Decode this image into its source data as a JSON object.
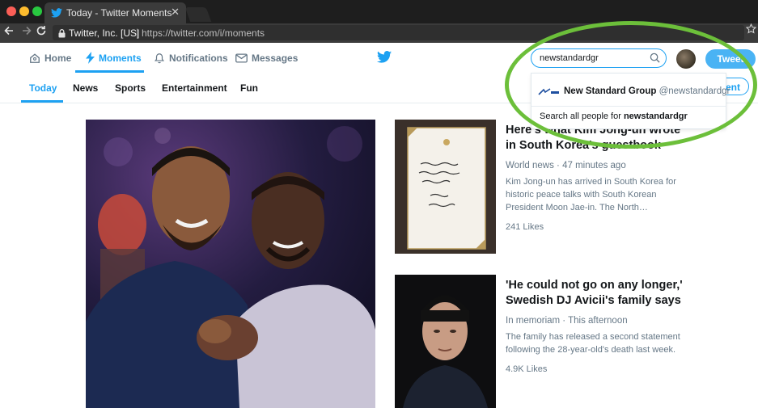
{
  "browser": {
    "tab_title": "Today - Twitter Moments",
    "tab_close": "✕",
    "origin": "Twitter, Inc. [US]",
    "separator": "|",
    "url": "https://twitter.com/i/moments"
  },
  "header": {
    "nav": [
      {
        "label": "Home",
        "icon": "home-icon"
      },
      {
        "label": "Moments",
        "icon": "lightning-icon",
        "active": true
      },
      {
        "label": "Notifications",
        "icon": "bell-icon"
      },
      {
        "label": "Messages",
        "icon": "envelope-icon"
      }
    ],
    "search_value": "newstandardgr",
    "tweet_label": "Tweet"
  },
  "categories": {
    "tabs": [
      "Today",
      "News",
      "Sports",
      "Entertainment",
      "Fun"
    ],
    "active": "Today",
    "follow_label": "ent"
  },
  "search_dropdown": {
    "result_name": "New Standard Group",
    "result_handle": "@newstandardgr",
    "search_all_prefix": "Search all people for ",
    "search_all_term": "newstandardgr"
  },
  "stories": [
    {
      "title": "Here's what Kim Jong-un wrote in South Korea's guestbook",
      "meta": "World news · 47 minutes ago",
      "description": "Kim Jong-un has arrived in South Korea for historic peace talks with South Korean President Moon Jae-in. The North…",
      "likes": "241 Likes"
    },
    {
      "title": "'He could not go on any longer,' Swedish DJ Avicii's family says",
      "meta": "In memoriam · This afternoon",
      "description": "The family has released a second statement following the 28-year-old's death last week.",
      "likes": "4.9K Likes"
    }
  ],
  "colors": {
    "twitter_blue": "#1da1f2",
    "annotation_green": "#6cbf3a",
    "text_dark": "#14171a",
    "text_muted": "#657786"
  }
}
